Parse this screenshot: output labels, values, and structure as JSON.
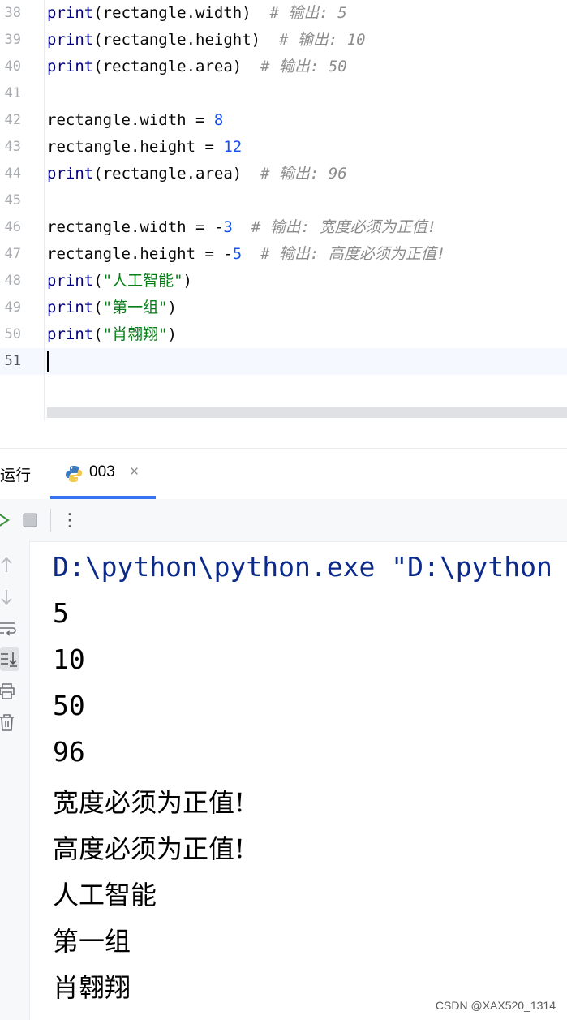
{
  "editor": {
    "line_numbers": [
      "38",
      "39",
      "40",
      "41",
      "42",
      "43",
      "44",
      "45",
      "46",
      "47",
      "48",
      "49",
      "50",
      "51"
    ],
    "lines": [
      [
        {
          "t": "print",
          "c": "fn"
        },
        {
          "t": "(rectangle.width)  "
        },
        {
          "t": "# 输出: 5",
          "c": "cmt"
        }
      ],
      [
        {
          "t": "print",
          "c": "fn"
        },
        {
          "t": "(rectangle.height)  "
        },
        {
          "t": "# 输出: 10",
          "c": "cmt"
        }
      ],
      [
        {
          "t": "print",
          "c": "fn"
        },
        {
          "t": "(rectangle.area)  "
        },
        {
          "t": "# 输出: 50",
          "c": "cmt"
        }
      ],
      [],
      [
        {
          "t": "rectangle.width = "
        },
        {
          "t": "8",
          "c": "num"
        }
      ],
      [
        {
          "t": "rectangle.height = "
        },
        {
          "t": "12",
          "c": "num"
        }
      ],
      [
        {
          "t": "print",
          "c": "fn"
        },
        {
          "t": "(rectangle.area)  "
        },
        {
          "t": "# 输出: 96",
          "c": "cmt"
        }
      ],
      [],
      [
        {
          "t": "rectangle.width = -"
        },
        {
          "t": "3",
          "c": "num"
        },
        {
          "t": "  "
        },
        {
          "t": "# 输出: 宽度必须为正值!",
          "c": "cmt"
        }
      ],
      [
        {
          "t": "rectangle.height = -"
        },
        {
          "t": "5",
          "c": "num"
        },
        {
          "t": "  "
        },
        {
          "t": "# 输出: 高度必须为正值!",
          "c": "cmt"
        }
      ],
      [
        {
          "t": "print",
          "c": "fn"
        },
        {
          "t": "("
        },
        {
          "t": "\"人工智能\"",
          "c": "str"
        },
        {
          "t": ")"
        }
      ],
      [
        {
          "t": "print",
          "c": "fn"
        },
        {
          "t": "("
        },
        {
          "t": "\"第一组\"",
          "c": "str"
        },
        {
          "t": ")"
        }
      ],
      [
        {
          "t": "print",
          "c": "fn"
        },
        {
          "t": "("
        },
        {
          "t": "\"肖翱翔\"",
          "c": "str"
        },
        {
          "t": ")"
        }
      ],
      []
    ]
  },
  "run": {
    "title": "运行",
    "tab_label": "003",
    "tab_close": "×",
    "more_menu": "⋮"
  },
  "console": {
    "command": "D:\\python\\python.exe \"D:\\python",
    "output": [
      "5",
      "10",
      "50",
      "96",
      "宽度必须为正值!",
      "高度必须为正值!",
      "人工智能",
      "第一组",
      "肖翱翔"
    ]
  },
  "watermark": "CSDN @XAX520_1314",
  "colors": {
    "keyword_fn": "#000080",
    "number": "#1750eb",
    "string": "#067d17",
    "comment": "#8c8c8c",
    "accent": "#3574f0"
  },
  "icons": [
    "python-file-icon",
    "rerun-icon",
    "stop-icon",
    "more-icon",
    "scroll-up-icon",
    "scroll-down-icon",
    "soft-wrap-icon",
    "scroll-to-end-icon",
    "print-icon",
    "trash-icon",
    "close-icon"
  ]
}
